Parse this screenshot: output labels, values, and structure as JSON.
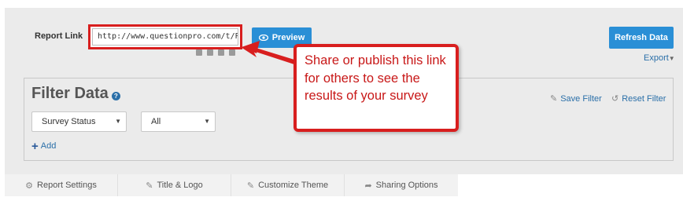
{
  "report_link": {
    "label": "Report Link",
    "url": "http://www.questionpro.com/t/PBI",
    "preview_label": "Preview",
    "social_icons": [
      "facebook-icon",
      "twitter-icon",
      "linkedin-icon",
      "email-icon"
    ]
  },
  "actions": {
    "refresh_label": "Refresh Data",
    "export_label": "Export"
  },
  "filter": {
    "title": "Filter Data",
    "save_label": "Save Filter",
    "reset_label": "Reset Filter",
    "field_select": "Survey Status",
    "value_select": "All",
    "add_label": "Add"
  },
  "tabs": [
    {
      "label": "Report Settings",
      "icon": "gears-icon"
    },
    {
      "label": "Title & Logo",
      "icon": "edit-icon"
    },
    {
      "label": "Customize Theme",
      "icon": "edit-icon"
    },
    {
      "label": "Sharing Options",
      "icon": "share-icon"
    }
  ],
  "callout": {
    "text": "Share or publish this link for others to see the results of your survey"
  },
  "colors": {
    "accent_blue": "#2a8fd6",
    "link_blue": "#2a6fa8",
    "highlight_red": "#d81e1e",
    "panel_gray": "#ebebeb"
  }
}
